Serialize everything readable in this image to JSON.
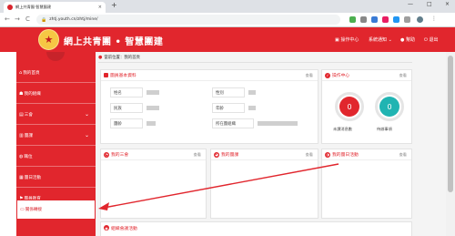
{
  "browser": {
    "tab_title": "網上共青團·智慧團建",
    "tab_close": "×",
    "new_tab": "+",
    "url": "zhtj.youth.cn/zhtj/mine/",
    "back": "←",
    "forward": "→",
    "reload": "C",
    "window_min": "—",
    "window_max": "□",
    "window_close": "×"
  },
  "header": {
    "title": "網上共青團 • 智慧團建",
    "operation_center": "操作中心",
    "system_notice": "系統通知",
    "help": "幫助",
    "logout": "退出"
  },
  "sidebar": {
    "items": [
      {
        "label": "我的首頁"
      },
      {
        "label": "我的組織"
      },
      {
        "label": "三會"
      },
      {
        "label": "團課"
      },
      {
        "label": "職位"
      },
      {
        "label": "團日活動"
      },
      {
        "label": "團員教育"
      },
      {
        "label": "關係轉接"
      }
    ]
  },
  "main": {
    "breadcrumb": "當前位置：我的首頁",
    "basic_info": {
      "title": "團員基本資料",
      "more": "查看",
      "labels": [
        "姓名",
        "民族",
        "團齡",
        "性別",
        "年齡",
        "所在團組織"
      ]
    },
    "ops_center": {
      "title": "操作中心",
      "more": "查看",
      "items": [
        {
          "value": "0",
          "label": "未讀消息數",
          "color": "#e1262d"
        },
        {
          "value": "0",
          "label": "待辦事項",
          "color": "#20b4b2"
        }
      ]
    },
    "my_three_meetings": {
      "title": "我的三會",
      "more": "查看"
    },
    "my_group_lesson": {
      "title": "我的團課",
      "more": "查看"
    },
    "my_league_day": {
      "title": "我的團日活動",
      "more": "查看"
    },
    "recent_activity": {
      "title": "組織會議活動"
    }
  },
  "colors": {
    "brand_red": "#e1262d",
    "teal": "#20b4b2"
  }
}
